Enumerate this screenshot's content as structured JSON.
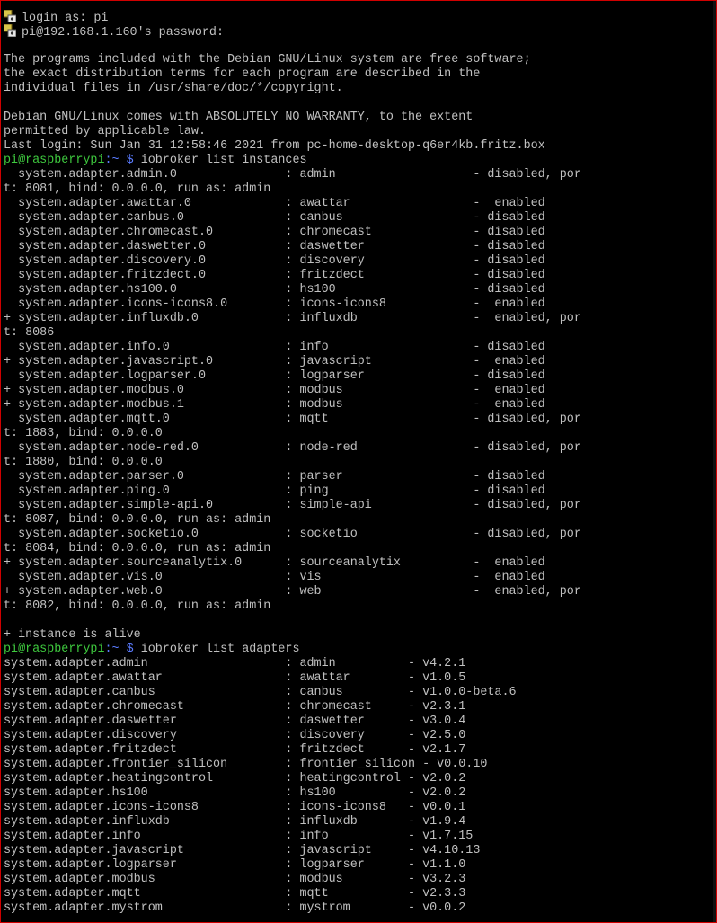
{
  "terminal": {
    "login_lines": [
      {
        "icon": "key-icon",
        "text": "login as: pi"
      },
      {
        "icon": "key-icon",
        "text": "pi@192.168.1.160's password:"
      }
    ],
    "lines": [
      "",
      "The programs included with the Debian GNU/Linux system are free software;",
      "the exact distribution terms for each program are described in the",
      "individual files in /usr/share/doc/*/copyright.",
      "",
      "Debian GNU/Linux comes with ABSOLUTELY NO WARRANTY, to the extent",
      "permitted by applicable law.",
      "Last login: Sun Jan 31 12:58:46 2021 from pc-home-desktop-q6er4kb.fritz.box"
    ],
    "prompt1": {
      "user": "pi@raspberrypi",
      "path": ":~ $",
      "command": " iobroker list instances"
    },
    "instances_output": [
      "  system.adapter.admin.0               : admin                   - disabled, por",
      "t: 8081, bind: 0.0.0.0, run as: admin",
      "  system.adapter.awattar.0             : awattar                 -  enabled",
      "  system.adapter.canbus.0              : canbus                  - disabled",
      "  system.adapter.chromecast.0          : chromecast              - disabled",
      "  system.adapter.daswetter.0           : daswetter               - disabled",
      "  system.adapter.discovery.0           : discovery               - disabled",
      "  system.adapter.fritzdect.0           : fritzdect               - disabled",
      "  system.adapter.hs100.0               : hs100                   - disabled",
      "  system.adapter.icons-icons8.0        : icons-icons8            -  enabled",
      "+ system.adapter.influxdb.0            : influxdb                -  enabled, por",
      "t: 8086",
      "  system.adapter.info.0                : info                    - disabled",
      "+ system.adapter.javascript.0          : javascript              -  enabled",
      "  system.adapter.logparser.0           : logparser               - disabled",
      "+ system.adapter.modbus.0              : modbus                  -  enabled",
      "+ system.adapter.modbus.1              : modbus                  -  enabled",
      "  system.adapter.mqtt.0                : mqtt                    - disabled, por",
      "t: 1883, bind: 0.0.0.0",
      "  system.adapter.node-red.0            : node-red                - disabled, por",
      "t: 1880, bind: 0.0.0.0",
      "  system.adapter.parser.0              : parser                  - disabled",
      "  system.adapter.ping.0                : ping                    - disabled",
      "  system.adapter.simple-api.0          : simple-api              - disabled, por",
      "t: 8087, bind: 0.0.0.0, run as: admin",
      "  system.adapter.socketio.0            : socketio                - disabled, por",
      "t: 8084, bind: 0.0.0.0, run as: admin",
      "+ system.adapter.sourceanalytix.0      : sourceanalytix          -  enabled",
      "  system.adapter.vis.0                 : vis                     -  enabled",
      "+ system.adapter.web.0                 : web                     -  enabled, por",
      "t: 8082, bind: 0.0.0.0, run as: admin",
      "",
      "+ instance is alive"
    ],
    "prompt2": {
      "user": "pi@raspberrypi",
      "path": ":~ $",
      "command": " iobroker list adapters"
    },
    "adapters_output": [
      "system.adapter.admin                   : admin          - v4.2.1",
      "system.adapter.awattar                 : awattar        - v1.0.5",
      "system.adapter.canbus                  : canbus         - v1.0.0-beta.6",
      "system.adapter.chromecast              : chromecast     - v2.3.1",
      "system.adapter.daswetter               : daswetter      - v3.0.4",
      "system.adapter.discovery               : discovery      - v2.5.0",
      "system.adapter.fritzdect               : fritzdect      - v2.1.7",
      "system.adapter.frontier_silicon        : frontier_silicon - v0.0.10",
      "system.adapter.heatingcontrol          : heatingcontrol - v2.0.2",
      "system.adapter.hs100                   : hs100          - v2.0.2",
      "system.adapter.icons-icons8            : icons-icons8   - v0.0.1",
      "system.adapter.influxdb                : influxdb       - v1.9.4",
      "system.adapter.info                    : info           - v1.7.15",
      "system.adapter.javascript              : javascript     - v4.10.13",
      "system.adapter.logparser               : logparser      - v1.1.0",
      "system.adapter.modbus                  : modbus         - v3.2.3",
      "system.adapter.mqtt                    : mqtt           - v2.3.3",
      "system.adapter.mystrom                 : mystrom        - v0.0.2"
    ],
    "colors": {
      "background": "#000000",
      "text": "#c0c0c0",
      "prompt_user": "#3ec93e",
      "prompt_path": "#5a7bff",
      "border": "#d00000"
    }
  }
}
